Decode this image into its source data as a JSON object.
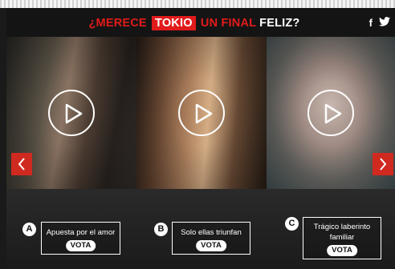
{
  "header": {
    "title_parts": [
      "¿MERECE",
      "TOKIO",
      "UN FINAL",
      "FELIZ?"
    ],
    "social": {
      "facebook": "f",
      "twitter": "t"
    }
  },
  "nav": {
    "prev_icon": "chevron-left-icon",
    "next_icon": "chevron-right-icon"
  },
  "options": [
    {
      "letter": "A",
      "label": "Apuesta por el amor",
      "button": "VOTA"
    },
    {
      "letter": "B",
      "label": "Solo ellas triunfan",
      "button": "VOTA"
    },
    {
      "letter": "C",
      "label_line1": "Trágico laberinto",
      "label_line2": "familiar",
      "button": "VOTA"
    }
  ],
  "colors": {
    "accent": "#e11b1b",
    "arrow": "#d0291f",
    "header_bg": "#141414"
  }
}
